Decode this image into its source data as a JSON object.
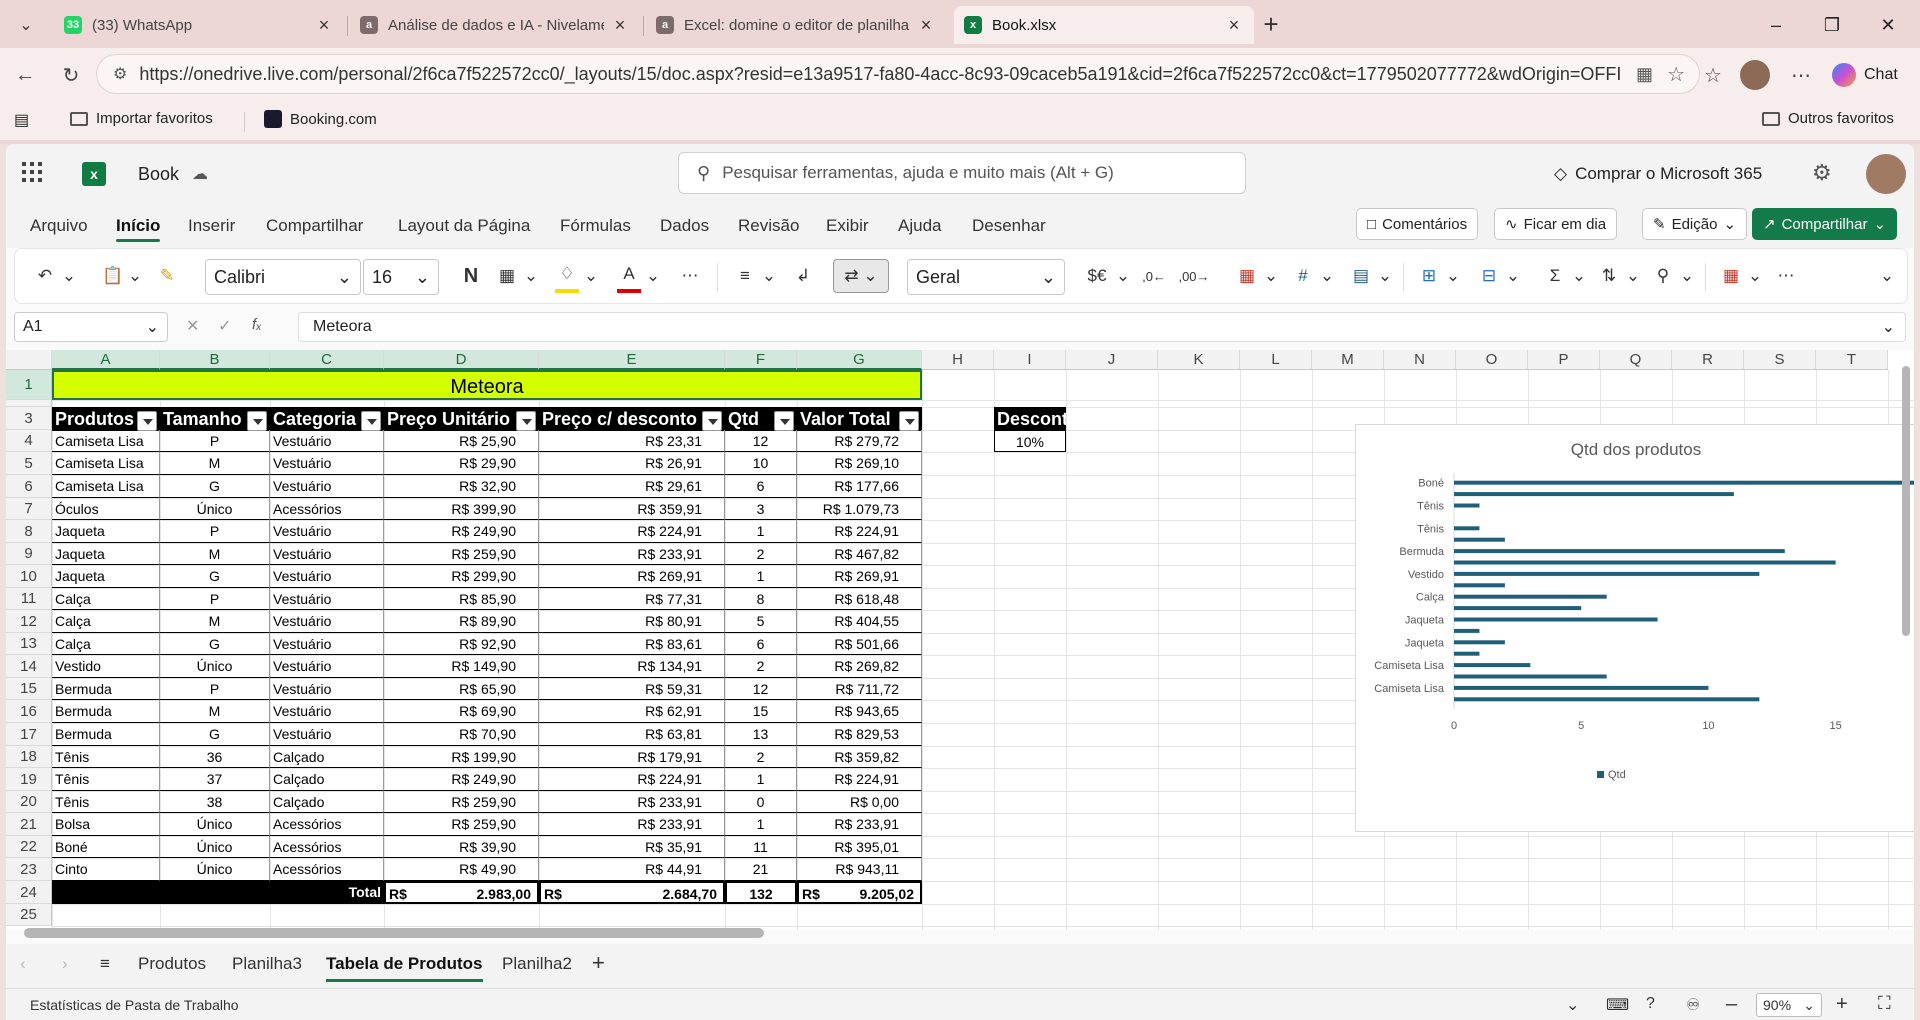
{
  "browser": {
    "tabs": [
      {
        "title": "(33) WhatsApp",
        "badge": "33",
        "icon": "whatsapp-icon",
        "color": "#25d366"
      },
      {
        "title": "Análise de dados e IA - Nivelamen",
        "badge": "a",
        "icon": "alura-icon",
        "color": "#7d6a6a"
      },
      {
        "title": "Excel: domine o editor de planilha",
        "badge": "a",
        "icon": "alura-icon",
        "color": "#7d6a6a"
      },
      {
        "title": "Book.xlsx",
        "badge": "x",
        "icon": "excel-icon",
        "color": "#107c41"
      }
    ],
    "url": "https://onedrive.live.com/personal/2f6ca7f522572cc0/_layouts/15/doc.aspx?resid=e13a9517-fa80-4acc-8c93-09caceb5a191&cid=2f6ca7f522572cc0&ct=1779502077772&wdOrigin=OFFICE...",
    "chat_label": "Chat",
    "favorites": {
      "import": "Importar favoritos",
      "booking": "Booking.com",
      "others": "Outros favoritos"
    }
  },
  "excel": {
    "doc_name": "Book",
    "search_placeholder": "Pesquisar ferramentas, ajuda e muito mais (Alt + G)",
    "buy": "Comprar o Microsoft 365",
    "menu": [
      "Arquivo",
      "Início",
      "Inserir",
      "Compartilhar",
      "Layout da Página",
      "Fórmulas",
      "Dados",
      "Revisão",
      "Exibir",
      "Ajuda",
      "Desenhar"
    ],
    "comments": "Comentários",
    "catch_up": "Ficar em dia",
    "editing": "Edição",
    "share": "Compartilhar",
    "font": "Calibri",
    "font_size": "16",
    "number_format": "Geral",
    "bold_glyph": "N",
    "currency_glyph": "$€",
    "name_box": "A1",
    "formula": "Meteora",
    "columns": [
      "A",
      "B",
      "C",
      "D",
      "E",
      "F",
      "G",
      "H",
      "I",
      "J",
      "K",
      "L",
      "M",
      "N",
      "O",
      "P",
      "Q",
      "R",
      "S",
      "T"
    ],
    "rows": [
      "1",
      "3",
      "4",
      "5",
      "6",
      "7",
      "8",
      "9",
      "10",
      "11",
      "12",
      "13",
      "14",
      "15",
      "16",
      "17",
      "18",
      "19",
      "20",
      "21",
      "22",
      "23",
      "24",
      "25"
    ],
    "title_cell": "Meteora",
    "table_headers": [
      "Produtos",
      "Tamanho",
      "Categoria",
      "Preço Unitário",
      "Preço c/ desconto",
      "Qtd",
      "Valor Total"
    ],
    "table_rows": [
      [
        "Camiseta Lisa",
        "P",
        "Vestuário",
        "R$ 25,90",
        "R$ 23,31",
        "12",
        "R$ 279,72"
      ],
      [
        "Camiseta Lisa",
        "M",
        "Vestuário",
        "R$ 29,90",
        "R$ 26,91",
        "10",
        "R$ 269,10"
      ],
      [
        "Camiseta Lisa",
        "G",
        "Vestuário",
        "R$ 32,90",
        "R$ 29,61",
        "6",
        "R$ 177,66"
      ],
      [
        "Óculos",
        "Único",
        "Acessórios",
        "R$ 399,90",
        "R$ 359,91",
        "3",
        "R$ 1.079,73"
      ],
      [
        "Jaqueta",
        "P",
        "Vestuário",
        "R$ 249,90",
        "R$ 224,91",
        "1",
        "R$ 224,91"
      ],
      [
        "Jaqueta",
        "M",
        "Vestuário",
        "R$ 259,90",
        "R$ 233,91",
        "2",
        "R$ 467,82"
      ],
      [
        "Jaqueta",
        "G",
        "Vestuário",
        "R$ 299,90",
        "R$ 269,91",
        "1",
        "R$ 269,91"
      ],
      [
        "Calça",
        "P",
        "Vestuário",
        "R$ 85,90",
        "R$ 77,31",
        "8",
        "R$ 618,48"
      ],
      [
        "Calça",
        "M",
        "Vestuário",
        "R$ 89,90",
        "R$ 80,91",
        "5",
        "R$ 404,55"
      ],
      [
        "Calça",
        "G",
        "Vestuário",
        "R$ 92,90",
        "R$ 83,61",
        "6",
        "R$ 501,66"
      ],
      [
        "Vestido",
        "Único",
        "Vestuário",
        "R$ 149,90",
        "R$ 134,91",
        "2",
        "R$ 269,82"
      ],
      [
        "Bermuda",
        "P",
        "Vestuário",
        "R$ 65,90",
        "R$ 59,31",
        "12",
        "R$ 711,72"
      ],
      [
        "Bermuda",
        "M",
        "Vestuário",
        "R$ 69,90",
        "R$ 62,91",
        "15",
        "R$ 943,65"
      ],
      [
        "Bermuda",
        "G",
        "Vestuário",
        "R$ 70,90",
        "R$ 63,81",
        "13",
        "R$ 829,53"
      ],
      [
        "Tênis",
        "36",
        "Calçado",
        "R$ 199,90",
        "R$ 179,91",
        "2",
        "R$ 359,82"
      ],
      [
        "Tênis",
        "37",
        "Calçado",
        "R$ 249,90",
        "R$ 224,91",
        "1",
        "R$ 224,91"
      ],
      [
        "Tênis",
        "38",
        "Calçado",
        "R$ 259,90",
        "R$ 233,91",
        "0",
        "R$ 0,00"
      ],
      [
        "Bolsa",
        "Único",
        "Acessórios",
        "R$ 259,90",
        "R$ 233,91",
        "1",
        "R$ 233,91"
      ],
      [
        "Boné",
        "Único",
        "Acessórios",
        "R$ 39,90",
        "R$ 35,91",
        "11",
        "R$ 395,01"
      ],
      [
        "Cinto",
        "Único",
        "Acessórios",
        "R$ 49,90",
        "R$ 44,91",
        "21",
        "R$ 943,11"
      ]
    ],
    "total_row": {
      "label": "Total",
      "currency": "R$",
      "d": "2.983,00",
      "e": "2.684,70",
      "f": "132",
      "g": "9.205,02"
    },
    "discount": {
      "label": "Desconto",
      "value": "10%"
    },
    "sheet_tabs": [
      "Produtos",
      "Planilha3",
      "Tabela de Produtos",
      "Planilha2"
    ],
    "active_sheet": "Tabela de Produtos",
    "status_left": "Estatísticas de Pasta de Trabalho",
    "zoom": "90%",
    "colors": {
      "title_fill": "#d4ff00",
      "chart_bar": "#1f5f7a",
      "accent": "#137a4a"
    }
  },
  "chart_data": {
    "type": "bar",
    "orientation": "horizontal",
    "title": "Qtd dos produtos",
    "categories": [
      "Camiseta Lisa",
      "Camiseta Lisa",
      "Camiseta Lisa",
      "Óculos",
      "Jaqueta",
      "Jaqueta",
      "Jaqueta",
      "Calça",
      "Calça",
      "Calça",
      "Vestido",
      "Bermuda",
      "Bermuda",
      "Bermuda",
      "Tênis",
      "Tênis",
      "Tênis",
      "Bolsa",
      "Boné",
      "Cinto"
    ],
    "visible_category_labels": [
      "Camiseta Lisa",
      "Camiseta Lisa",
      "Jaqueta",
      "Jaqueta",
      "Calça",
      "Vestido",
      "Bermuda",
      "Tênis",
      "Tênis",
      "Boné"
    ],
    "series": [
      {
        "name": "Qtd",
        "values": [
          12,
          10,
          6,
          3,
          1,
          2,
          1,
          8,
          5,
          6,
          2,
          12,
          15,
          13,
          2,
          1,
          0,
          1,
          11,
          21
        ]
      }
    ],
    "xlim": [
      0,
      18
    ],
    "xticks": [
      0,
      5,
      10,
      15
    ],
    "legend": "bottom"
  }
}
